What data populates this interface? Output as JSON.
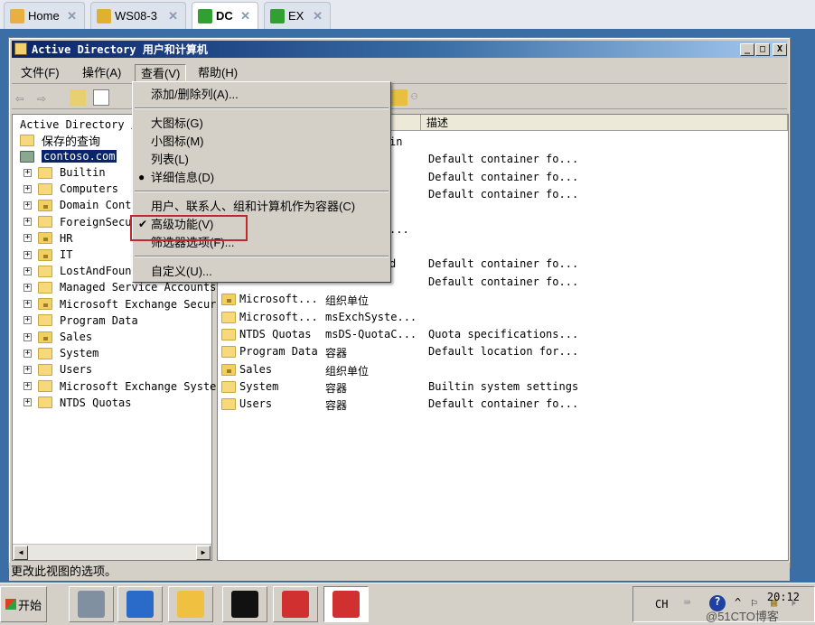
{
  "tabs": [
    {
      "label": "Home",
      "icon": "home-icon",
      "color": "#e8b040"
    },
    {
      "label": "WS08-3",
      "icon": "vm-icon",
      "color": "#e0b030"
    },
    {
      "label": "DC",
      "icon": "vm-running-icon",
      "color": "#30a030",
      "active": true
    },
    {
      "label": "EX",
      "icon": "vm-running-icon",
      "color": "#30a030"
    }
  ],
  "window": {
    "title": "Active Directory 用户和计算机",
    "minimize": "_",
    "maximize": "□",
    "close": "X"
  },
  "menubar": [
    "文件(F)",
    "操作(A)",
    "查看(V)",
    "帮助(H)"
  ],
  "view_menu": {
    "items": [
      {
        "label": "添加/删除列(A)..."
      },
      {
        "label": "大图标(G)"
      },
      {
        "label": "小图标(M)"
      },
      {
        "label": "列表(L)"
      },
      {
        "label": "详细信息(D)",
        "mark": "●"
      },
      {
        "label": "用户、联系人、组和计算机作为容器(C)"
      },
      {
        "label": "高级功能(V)",
        "mark": "✔",
        "highlighted": true
      },
      {
        "label": "筛选器选项(F)..."
      },
      {
        "label": "自定义(U)..."
      }
    ]
  },
  "tree": {
    "header": "Active Directory 用",
    "saved_queries": "保存的查询",
    "domain": "contoso.com",
    "items": [
      {
        "label": "Builtin"
      },
      {
        "label": "Computers"
      },
      {
        "label": "Domain Contr",
        "ou": true
      },
      {
        "label": "ForeignSecur"
      },
      {
        "label": "HR",
        "ou": true
      },
      {
        "label": "IT",
        "ou": true
      },
      {
        "label": "LostAndFound"
      },
      {
        "label": "Managed Service Accounts"
      },
      {
        "label": "Microsoft Exchange Secur",
        "ou": true
      },
      {
        "label": "Program Data"
      },
      {
        "label": "Sales",
        "ou": true
      },
      {
        "label": "System"
      },
      {
        "label": "Users"
      },
      {
        "label": "Microsoft Exchange Syste"
      },
      {
        "label": "NTDS Quotas"
      }
    ]
  },
  "list": {
    "columns": [
      "名称",
      "类型",
      "描述"
    ],
    "rows": [
      {
        "name": "",
        "type": "in",
        "desc": ""
      },
      {
        "name": "",
        "type": "",
        "desc": "Default container fo..."
      },
      {
        "name": "",
        "type": "",
        "desc": "Default container fo..."
      },
      {
        "name": "",
        "type": "",
        "desc": "Default container fo..."
      },
      {
        "name": "",
        "type": "",
        "desc": ""
      },
      {
        "name": "",
        "type": "...",
        "desc": ""
      },
      {
        "name": "",
        "type": "",
        "desc": ""
      },
      {
        "name": "",
        "type": "d",
        "desc": "Default container fo..."
      },
      {
        "name": "",
        "type": "",
        "desc": "Default container fo..."
      },
      {
        "name": "Microsoft...",
        "type": "组织单位",
        "desc": "",
        "ou": true
      },
      {
        "name": "Microsoft...",
        "type": "msExchSyste...",
        "desc": ""
      },
      {
        "name": "NTDS Quotas",
        "type": "msDS-QuotaC...",
        "desc": "Quota specifications..."
      },
      {
        "name": "Program Data",
        "type": "容器",
        "desc": "Default location for..."
      },
      {
        "name": "Sales",
        "type": "组织单位",
        "desc": "",
        "ou": true
      },
      {
        "name": "System",
        "type": "容器",
        "desc": "Builtin system settings"
      },
      {
        "name": "Users",
        "type": "容器",
        "desc": "Default container fo..."
      }
    ]
  },
  "status": "更改此视图的选项。",
  "taskbar": {
    "start": "开始",
    "items": [
      {
        "icon": "server-manager-icon",
        "color": "#8090a0"
      },
      {
        "icon": "powershell-icon",
        "color": "#2a6ac8"
      },
      {
        "icon": "explorer-icon",
        "color": "#f0c040"
      },
      {
        "icon": "cmd-icon",
        "color": "#111111"
      },
      {
        "icon": "ad-tools-icon",
        "color": "#d03030"
      },
      {
        "icon": "ad-tools-icon",
        "color": "#d03030",
        "active": true
      }
    ],
    "lang": "CH",
    "clock": "20:12",
    "watermark": "@51CTO博客"
  }
}
